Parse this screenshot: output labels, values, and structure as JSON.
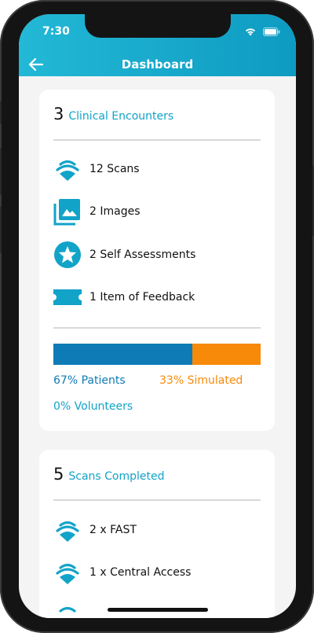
{
  "status": {
    "time": "7:30"
  },
  "header": {
    "title": "Dashboard"
  },
  "encounters": {
    "count": "3",
    "label": "Clinical Encounters",
    "items": [
      {
        "icon": "scan-waves-icon",
        "text": "12 Scans"
      },
      {
        "icon": "images-icon",
        "text": "2 Images"
      },
      {
        "icon": "star-badge-icon",
        "text": "2 Self Assessments"
      },
      {
        "icon": "ticket-icon",
        "text": "1 Item of Feedback"
      }
    ],
    "breakdown": {
      "patients_pct": 67,
      "simulated_pct": 33,
      "volunteers_pct": 0,
      "patients_label": "67% Patients",
      "simulated_label": "33% Simulated",
      "volunteers_label": "0% Volunteers"
    }
  },
  "scans": {
    "count": "5",
    "label": "Scans Completed",
    "items": [
      {
        "icon": "scan-waves-icon",
        "text": "2 x FAST"
      },
      {
        "icon": "scan-waves-icon",
        "text": "1 x Central Access"
      }
    ]
  },
  "colors": {
    "accent": "#12a3c8",
    "patients": "#0e7bb6",
    "simulated": "#f78a09",
    "volunteers": "#12a3c8"
  }
}
